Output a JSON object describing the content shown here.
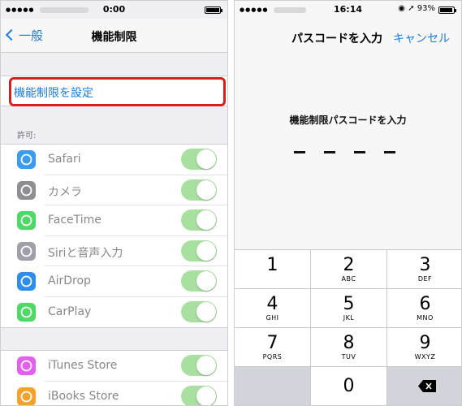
{
  "left": {
    "status": {
      "dots": "●●●●●",
      "time": "0:00",
      "battery_level": 1.0
    },
    "nav": {
      "back_label": "一般",
      "title": "機能制限"
    },
    "setup_label": "機能制限を設定",
    "allow_header": "許可:",
    "apps_group1": [
      {
        "label": "Safari",
        "icon": "safari-icon",
        "color": "#3a9cf0"
      },
      {
        "label": "カメラ",
        "icon": "camera-icon",
        "color": "#8e8e93"
      },
      {
        "label": "FaceTime",
        "icon": "facetime-icon",
        "color": "#4cd964"
      },
      {
        "label": "Siriと音声入力",
        "icon": "siri-icon",
        "color": "#a0a0a8"
      },
      {
        "label": "AirDrop",
        "icon": "airdrop-icon",
        "color": "#2d8ef0"
      },
      {
        "label": "CarPlay",
        "icon": "carplay-icon",
        "color": "#4cd964"
      }
    ],
    "apps_group2": [
      {
        "label": "iTunes Store",
        "icon": "itunes-store-icon",
        "color": "#e45ef0"
      },
      {
        "label": "iBooks Store",
        "icon": "ibooks-store-icon",
        "color": "#f7a12c"
      }
    ],
    "toggle_color": "#a8e0a0"
  },
  "right": {
    "status": {
      "dots": "●●●●●",
      "time": "16:14",
      "right_text": "◉ ➚ 93%",
      "battery_level": 0.93
    },
    "nav": {
      "title": "パスコードを入力",
      "cancel_label": "キャンセル"
    },
    "prompt": "機能制限パスコードを入力",
    "keys": [
      {
        "num": "1",
        "letters": ""
      },
      {
        "num": "2",
        "letters": "ABC"
      },
      {
        "num": "3",
        "letters": "DEF"
      },
      {
        "num": "4",
        "letters": "GHI"
      },
      {
        "num": "5",
        "letters": "JKL"
      },
      {
        "num": "6",
        "letters": "MNO"
      },
      {
        "num": "7",
        "letters": "PQRS"
      },
      {
        "num": "8",
        "letters": "TUV"
      },
      {
        "num": "9",
        "letters": "WXYZ"
      },
      {
        "num": "0",
        "letters": ""
      }
    ]
  }
}
